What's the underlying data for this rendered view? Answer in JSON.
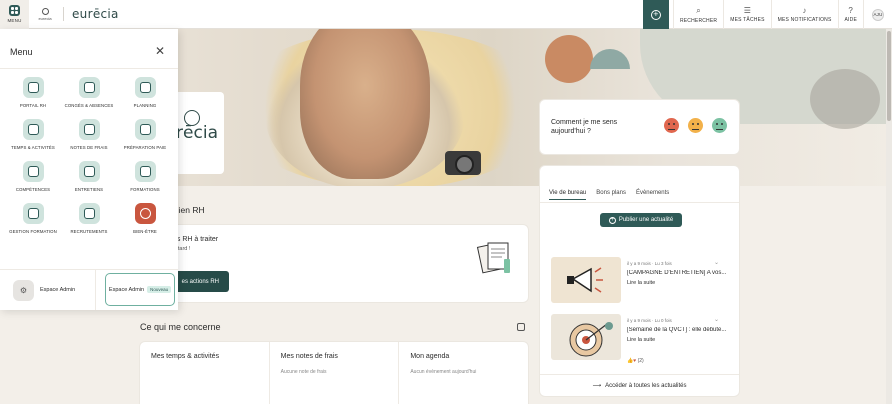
{
  "topbar": {
    "menu_label": "MENU",
    "small_logo": "eurecia",
    "brand": "eurēcia",
    "items": [
      {
        "label": "RECHERCHER",
        "icon": "search-icon"
      },
      {
        "label": "MES TÂCHES",
        "icon": "tasks-icon"
      },
      {
        "label": "MES NOTIFICATIONS",
        "icon": "bell-icon"
      },
      {
        "label": "AIDE",
        "icon": "help-icon"
      }
    ],
    "user_initials": "AJU"
  },
  "hero": {
    "logo_text": "eurēcia"
  },
  "menu": {
    "title": "Menu",
    "apps": [
      {
        "label": "PORTAIL RH",
        "icon": "portal-icon"
      },
      {
        "label": "CONGÉS & ABSENCES",
        "icon": "leave-icon"
      },
      {
        "label": "PLANNING",
        "icon": "planning-icon"
      },
      {
        "label": "TEMPS & ACTIVITÉS",
        "icon": "time-icon"
      },
      {
        "label": "NOTES DE FRAIS",
        "icon": "expenses-icon"
      },
      {
        "label": "PRÉPARATION PAIE",
        "icon": "payroll-icon"
      },
      {
        "label": "COMPÉTENCES",
        "icon": "skills-icon"
      },
      {
        "label": "ENTRETIENS",
        "icon": "interviews-icon"
      },
      {
        "label": "FORMATIONS",
        "icon": "training-icon"
      },
      {
        "label": "GESTION FORMATION",
        "icon": "training-management-icon"
      },
      {
        "label": "RECRUTEMENTS",
        "icon": "recruitment-icon"
      },
      {
        "label": "BIEN-ÊTRE",
        "icon": "wellbeing-icon"
      }
    ],
    "admin_label": "Espace Admin",
    "admin_new_label": "Espace Admin",
    "admin_new_badge": "Nouveau"
  },
  "mood": {
    "question": "Comment je me sens aujourd'hui ?"
  },
  "news": {
    "tabs": [
      "Vie de bureau",
      "Bons plans",
      "Évènements"
    ],
    "publish_label": "Publier une actualité",
    "articles": [
      {
        "meta": "il y a 9 mois · Lu 3 fois",
        "title": "[CAMPAGNE D'ENTRETIEN] A vos...",
        "more": "Lire la suite",
        "likes": ""
      },
      {
        "meta": "il y a 9 mois · Lu 0 fois",
        "title": "[Semaine de la QVCT] : elle débute...",
        "more": "Lire la suite",
        "likes": "(2)"
      }
    ],
    "footer": "Accéder à toutes les actualités"
  },
  "rh": {
    "title": "idien RH",
    "line1": "ns RH à traiter",
    "line2": "retard !",
    "button": "es actions RH"
  },
  "concern": {
    "title": "Ce qui me concerne",
    "tiles": [
      {
        "title": "Mes temps & activités",
        "sub": ""
      },
      {
        "title": "Mes notes de frais",
        "sub": "Aucune note de frais"
      },
      {
        "title": "Mon agenda",
        "sub": "Aucun évènement aujourd'hui"
      }
    ]
  },
  "colors": {
    "primary": "#2f5a57",
    "background": "#f3efe9",
    "accent_red": "#c9563f"
  }
}
